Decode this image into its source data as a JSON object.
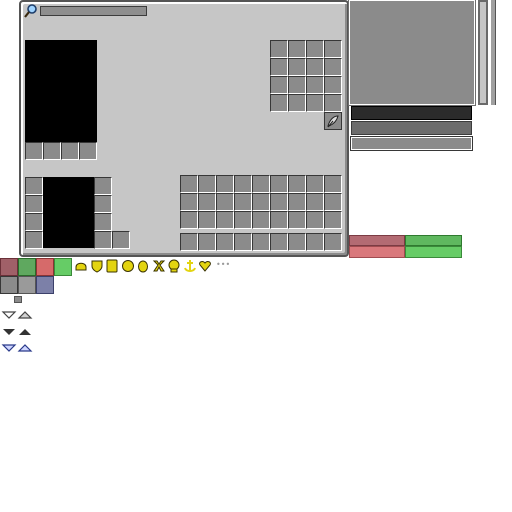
{
  "search": {
    "placeholder": ""
  },
  "colors": {
    "window_bg": "#c6c6c6",
    "slot": "#8b8b8b",
    "red_tile": "#c66a6a",
    "green_tile": "#63c063",
    "blue_tile": "#7c80a8",
    "effect_icon_yellow": "#e3d410"
  },
  "effect_icons": [
    "helmet-icon",
    "shield-icon",
    "scroll-icon",
    "circle-icon",
    "egg-icon",
    "cross-icon",
    "head-icon",
    "anchor-icon",
    "heart-icon"
  ],
  "more_indicator": "•••"
}
